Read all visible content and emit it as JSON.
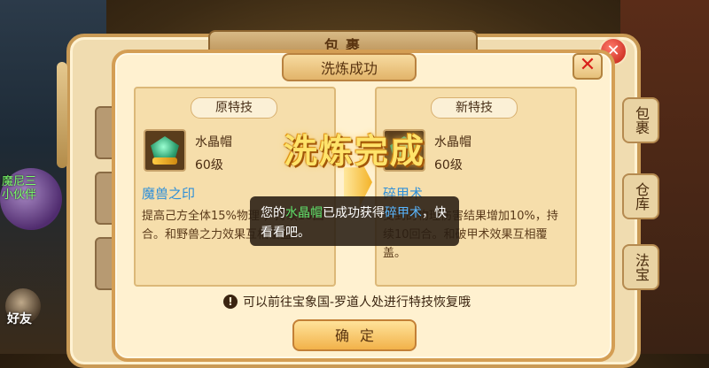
{
  "background": {
    "left_overlay_text": "魔尼三\n小伙伴",
    "friend_label": "好友"
  },
  "bag": {
    "title": "包裹",
    "close_icon": "close-x",
    "side_tabs": [
      "包裹",
      "仓库",
      "法宝"
    ]
  },
  "dialog": {
    "title": "洗炼成功",
    "close_icon": "close-x",
    "center_banner": "洗炼完成",
    "old": {
      "tag": "原特技",
      "item_name": "水晶帽",
      "item_level": "60级",
      "skill_name": "魔兽之印",
      "skill_desc": "提高己方全体15%物理 ，持续10回合。和野兽之力效果互相覆盖。"
    },
    "new": {
      "tag": "新特技",
      "item_name": "水晶帽",
      "item_level": "60级",
      "skill_name": "碎甲术",
      "skill_desc": "受到的物理伤害结果增加10%，持续10回合。和破甲术效果互相覆盖。"
    },
    "toast": {
      "prefix": "您的",
      "item": "水晶帽",
      "middle": "已成功获得",
      "skill": "碎甲术",
      "suffix": "，快看看吧。"
    },
    "tip": "可以前往宝象国-罗道人处进行特技恢复哦",
    "confirm_label": "确定"
  },
  "colors": {
    "panel_bg": "#fff1d0",
    "border": "#d49e54",
    "skill_blue": "#2f8fd8",
    "toast_item_green": "#5fe06a",
    "toast_skill_blue": "#59b6ff",
    "close_red": "#d8201a"
  }
}
